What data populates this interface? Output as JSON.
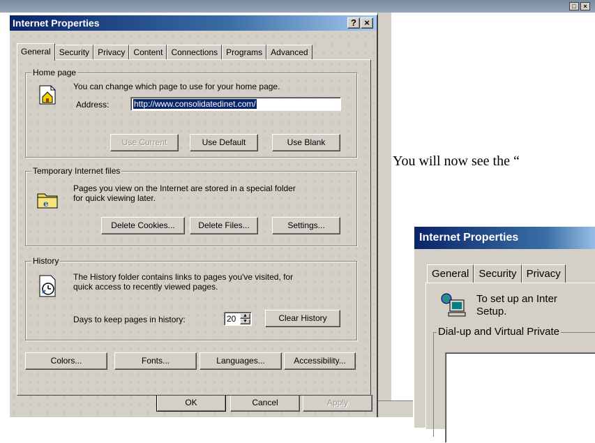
{
  "background": {
    "instruction_text": "You will now see the “"
  },
  "dialog": {
    "title": "Internet Properties",
    "help_label": "?",
    "close_label": "×",
    "tabs": [
      {
        "label": "General",
        "active": true
      },
      {
        "label": "Security"
      },
      {
        "label": "Privacy"
      },
      {
        "label": "Content"
      },
      {
        "label": "Connections"
      },
      {
        "label": "Programs"
      },
      {
        "label": "Advanced"
      }
    ],
    "home_page": {
      "group_label": "Home page",
      "description": "You can change which page to use for your home page.",
      "address_label": "Address:",
      "address_value": "http://www.consolidatedinet.com/",
      "use_current": "Use Current",
      "use_default": "Use Default",
      "use_blank": "Use Blank"
    },
    "temp_files": {
      "group_label": "Temporary Internet files",
      "description_line1": "Pages you view on the Internet are stored in a special folder",
      "description_line2": "for quick viewing later.",
      "delete_cookies": "Delete Cookies...",
      "delete_files": "Delete Files...",
      "settings": "Settings..."
    },
    "history": {
      "group_label": "History",
      "description_line1": "The History folder contains links to pages you've visited, for",
      "description_line2": "quick access to recently viewed pages.",
      "days_label": "Days to keep pages in history:",
      "days_value": "20",
      "clear_history": "Clear History"
    },
    "bottom_buttons": {
      "colors": "Colors...",
      "fonts": "Fonts...",
      "languages": "Languages...",
      "accessibility": "Accessibility..."
    },
    "footer": {
      "ok": "OK",
      "cancel": "Cancel",
      "apply": "Apply"
    }
  },
  "dialog2": {
    "title": "Internet Properties",
    "tabs": [
      "General",
      "Security",
      "Privacy"
    ],
    "connect_text_line1": "To set up an Inter",
    "connect_text_line2": "Setup.",
    "group_label": "Dial-up and Virtual Private"
  }
}
